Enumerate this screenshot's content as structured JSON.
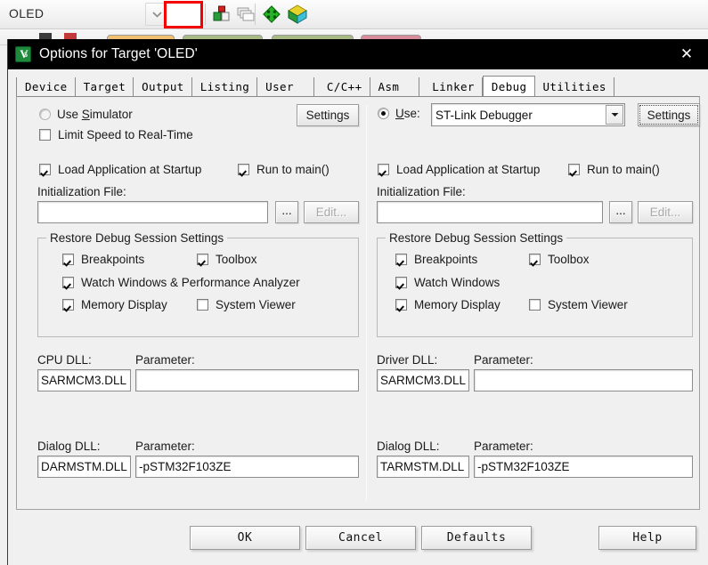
{
  "ide": {
    "target_combo_value": "OLED",
    "toolbar_icons": [
      {
        "name": "combo-dropdown-arrow",
        "title": "Select Target"
      },
      {
        "name": "magic-wand-icon",
        "title": "Configure Target Options (Magic Wand)"
      },
      {
        "name": "target-options-icon",
        "title": "Options for Target"
      },
      {
        "name": "manage-components-icon",
        "title": "Manage Project Items"
      },
      {
        "name": "pack-installer-icon",
        "title": "Pack Installer"
      },
      {
        "name": "manage-run-time-icon",
        "title": "Manage Run-Time Environment"
      }
    ]
  },
  "dialog": {
    "title": "Options for Target 'OLED'",
    "app_icon": "uvision-icon",
    "close_label": "✕",
    "tabs": [
      {
        "label": "Device",
        "active": false
      },
      {
        "label": "Target",
        "active": false
      },
      {
        "label": "Output",
        "active": false
      },
      {
        "label": "Listing",
        "active": false
      },
      {
        "label": "User",
        "active": false
      },
      {
        "label": "C/C++",
        "active": false
      },
      {
        "label": "Asm",
        "active": false
      },
      {
        "label": "Linker",
        "active": false
      },
      {
        "label": "Debug",
        "active": true
      },
      {
        "label": "Utilities",
        "active": false
      }
    ],
    "bottom_buttons": [
      {
        "label": "OK",
        "name": "ok-button"
      },
      {
        "label": "Cancel",
        "name": "cancel-button"
      },
      {
        "label": "Defaults",
        "name": "defaults-button"
      },
      {
        "label": "Help",
        "name": "help-button"
      }
    ]
  },
  "left": {
    "use_simulator_label": "Use ",
    "use_simulator_accel": "S",
    "use_simulator_label_rest": "imulator",
    "use_simulator_checked": false,
    "settings_label": "Settings",
    "limit_speed_label": "Limit Speed to Real-Time",
    "limit_speed_checked": false,
    "load_app_label": "Load Application at Startup",
    "load_app_checked": true,
    "run_to_main_label": "Run to main()",
    "run_to_main_checked": true,
    "init_file_label": "Initialization File:",
    "init_file_value": "",
    "browse_label": "...",
    "edit_label": "Edit...",
    "group_title": "Restore Debug Session Settings",
    "restore": [
      {
        "label": "Breakpoints",
        "checked": true
      },
      {
        "label": "Toolbox",
        "checked": true
      },
      {
        "label": "Watch Windows & Performance Analyzer",
        "checked": true
      },
      {
        "label": "Memory Display",
        "checked": true
      },
      {
        "label": "System Viewer",
        "checked": false
      }
    ],
    "cpu_dll_label": "CPU DLL:",
    "cpu_dll_value": "SARMCM3.DLL",
    "cpu_param_label": "Parameter:",
    "cpu_param_value": "",
    "dialog_dll_label": "Dialog DLL:",
    "dialog_dll_value": "DARMSTM.DLL",
    "dialog_param_label": "Parameter:",
    "dialog_param_value": "-pSTM32F103ZE"
  },
  "right": {
    "use_radio_label": "U",
    "use_radio_label_rest": "se:",
    "use_radio_checked": true,
    "debugger_value": "ST-Link Debugger",
    "settings_label": "Settings",
    "load_app_label": "Load Application at Startup",
    "load_app_checked": true,
    "run_to_main_label": "Run to main()",
    "run_to_main_checked": true,
    "init_file_label": "Initialization File:",
    "init_file_value": "",
    "browse_label": "...",
    "edit_label": "Edit...",
    "group_title": "Restore Debug Session Settings",
    "restore": [
      {
        "label": "Breakpoints",
        "checked": true
      },
      {
        "label": "Toolbox",
        "checked": true
      },
      {
        "label": "Watch Windows",
        "checked": true
      },
      {
        "label": "Memory Display",
        "checked": true
      },
      {
        "label": "System Viewer",
        "checked": false
      }
    ],
    "driver_dll_label": "Driver DLL:",
    "driver_dll_value": "SARMCM3.DLL",
    "driver_param_label": "Parameter:",
    "driver_param_value": "",
    "dialog_dll_label": "Dialog DLL:",
    "dialog_dll_value": "TARMSTM.DLL",
    "dialog_param_label": "Parameter:",
    "dialog_param_value": "-pSTM32F103ZE"
  },
  "annotations": {
    "highlight_color": "#f40000",
    "boxes": [
      {
        "name": "magic-wand-highlight",
        "target": "magic-wand toolbar button"
      },
      {
        "name": "debugger-select-highlight",
        "target": "ST-Link Debugger dropdown"
      }
    ]
  }
}
